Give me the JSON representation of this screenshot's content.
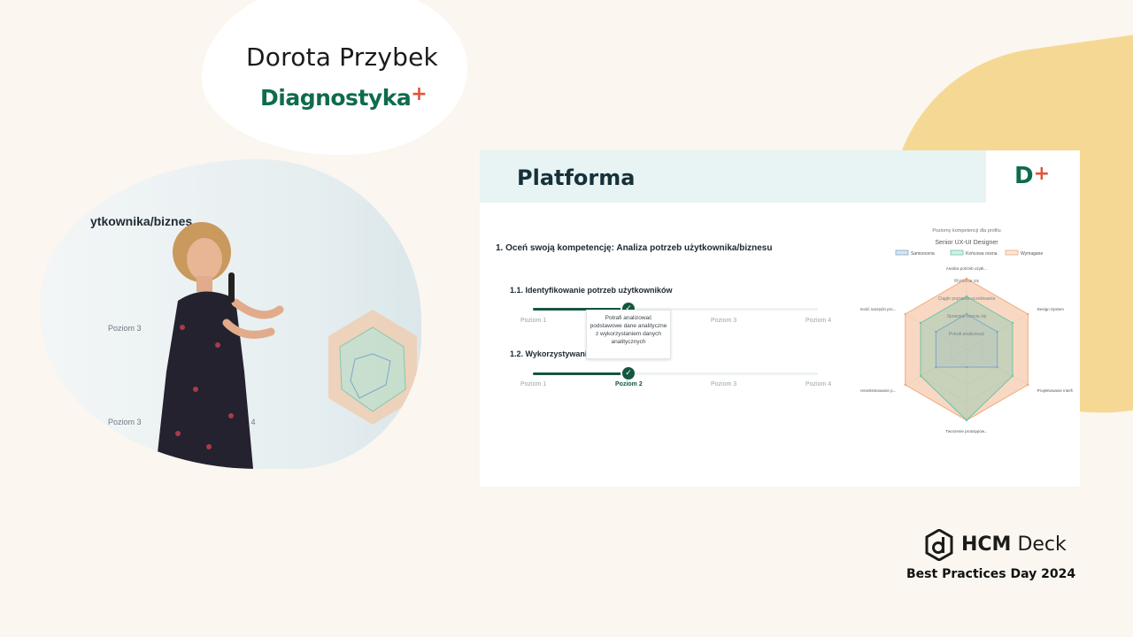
{
  "speaker": {
    "name": "Dorota Przybek",
    "company": "Diagnostyka",
    "company_plus": "+"
  },
  "photo": {
    "screen_text": "ytkownika/biznes",
    "small": [
      "Poziom 3",
      "Poziom 3",
      "Poziom 4"
    ]
  },
  "slide": {
    "title": "Platforma",
    "logo": "D",
    "logo_plus": "+",
    "question_main": "1. Oceń swoją kompetencję: Analiza potrzeb użytkownika/biznesu",
    "items": [
      {
        "label": "1.1. Identyfikowanie potrzeb użytkowników",
        "level": 2,
        "levels": [
          "Poziom 1",
          "Poziom 2",
          "Poziom 3",
          "Poziom 4"
        ]
      },
      {
        "label": "1.2. Wykorzystywani",
        "level": 2,
        "levels": [
          "Poziom 1",
          "Poziom 2",
          "Poziom 3",
          "Poziom 4"
        ]
      }
    ],
    "tooltip": "Potrafi analizować podstawowe dane analityczne z wykorzystaniem danych analitycznych",
    "chart": {
      "heading": "Poziomy kompetencji dla profilu",
      "subtitle": "Senior UX-UI Designer",
      "legend": [
        "Samoocena",
        "Końcowa ocena",
        "Wymagane"
      ],
      "colors": {
        "self": "#7ea7c9",
        "final": "#6cc5a8",
        "required": "#f1a879"
      }
    }
  },
  "chart_data": {
    "type": "radar",
    "title": "Poziomy kompetencji dla profilu",
    "subtitle": "Senior UX-UI Designer",
    "axes": [
      "Analiza potrzeb użytk...",
      "Design System",
      "Projektowanie interfej...",
      "Tworzenie prototypów...",
      "Tworzenie/testowanie p...",
      "Znajomość narzędzi pro..."
    ],
    "series": [
      {
        "name": "Samoocena",
        "values": [
          2,
          2,
          2,
          1,
          2,
          2
        ]
      },
      {
        "name": "Końcowa ocena",
        "values": [
          3,
          3,
          3,
          4,
          3,
          3
        ]
      },
      {
        "name": "Wymagane",
        "values": [
          4,
          4,
          4,
          4,
          4,
          4
        ]
      }
    ],
    "ring_labels": [
      "Potrafi analizować",
      "Sprawnie ocenia się",
      "Ciągle poprawia oczekiwania",
      "Wyróżnia się"
    ],
    "rmax": 4
  },
  "brand": {
    "name_bold": "HCM",
    "name": " Deck",
    "event": "Best Practices Day 2024"
  }
}
